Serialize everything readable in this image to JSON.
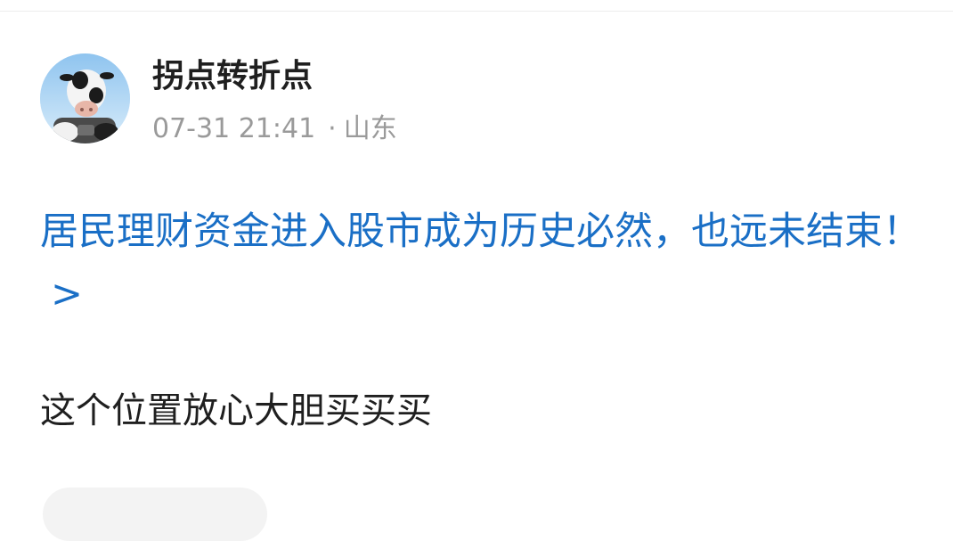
{
  "post": {
    "author": {
      "name": "拐点转折点",
      "avatar_icon": "cow-avatar-icon"
    },
    "meta": {
      "time": "07-31 21:41",
      "separator": "·",
      "location": "山东"
    },
    "link_title": {
      "text": "居民理财资金进入股市成为历史必然，也远未结束！",
      "arrow": ">"
    },
    "content": "这个位置放心大胆买买买"
  },
  "colors": {
    "link": "#1a6fc6",
    "meta": "#9a9a9a",
    "text": "#1f1f1f"
  }
}
